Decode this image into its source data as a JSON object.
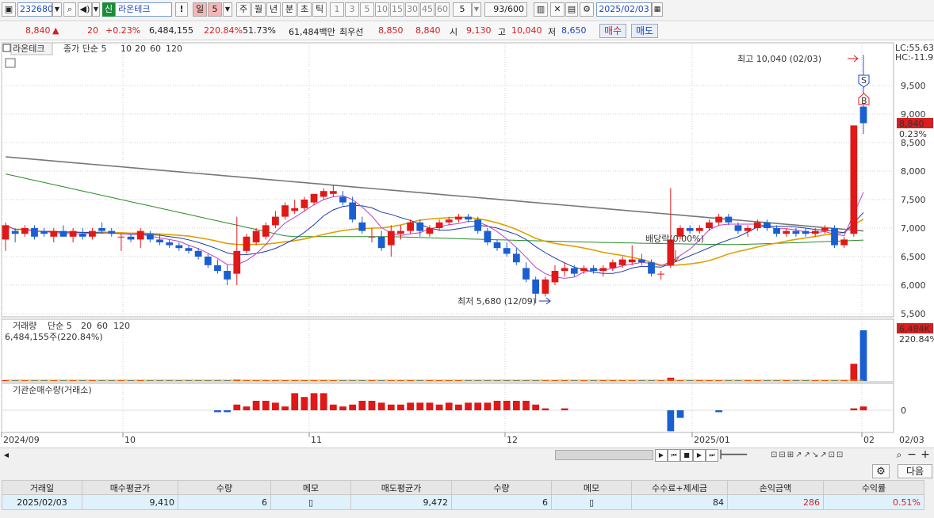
{
  "toolbar": {
    "code": "232680",
    "sin_badge": "신",
    "stock_name": "라온테크",
    "excl": "!",
    "period_day": "일",
    "period_num": "5",
    "week": "주",
    "month": "월",
    "year": "년",
    "minute": "분",
    "second": "초",
    "tick": "틱",
    "intervals": [
      "1",
      "3",
      "5",
      "10",
      "15",
      "30",
      "45",
      "60"
    ],
    "count_select": "5",
    "bar_count": "93/600",
    "date": "2025/02/03"
  },
  "quote": {
    "price": "8,840",
    "arrow": "▲",
    "change": "20",
    "change_pct": "+0.23%",
    "volume": "6,484,155",
    "volume_pct": "220.84%",
    "ratio": "51.73%",
    "amount": "61,484백만",
    "best_ask_label": "최우선",
    "best_ask": "8,850",
    "best_bid": "8,840",
    "open_label": "시",
    "open": "9,130",
    "high_label": "고",
    "high": "10,040",
    "low_label": "저",
    "low": "8,650",
    "buy_button": "매수",
    "sell_button": "매도"
  },
  "chart_data": [
    {
      "type": "candlestick",
      "legend_name": "라온테크",
      "legend_ma": [
        "종가 단순 5",
        "10",
        "20",
        "60",
        "120"
      ],
      "ma_colors": {
        "5": "#c040c0",
        "10": "#1e3aa8",
        "20": "#e0a000",
        "60": "#2a8a2a",
        "120": "#777777"
      },
      "y_ticks": [
        "9,500",
        "9,000",
        "8,500",
        "8,000",
        "7,500",
        "7,000",
        "6,500",
        "6,000",
        "5,500"
      ],
      "ylim": [
        5500,
        10040
      ],
      "x_ticks": [
        "2024/09",
        "10",
        "11",
        "12",
        "2025/01",
        "02",
        "02/03"
      ],
      "right_labels": {
        "lc": "LC:55.63",
        "hc": "HC:-11.9",
        "price": "8,840",
        "pct": "0.23%"
      },
      "annotations": {
        "high": "최고 10,040 (02/03)",
        "low": "최저 5,680 (12/09)",
        "dividend": "배당락(0.00%)",
        "sell_mark": "S",
        "buy_mark": "B"
      },
      "candles": [
        [
          6800,
          7100,
          6600,
          7050
        ],
        [
          6950,
          7000,
          6750,
          6900
        ],
        [
          6900,
          7050,
          6850,
          7000
        ],
        [
          7000,
          7050,
          6800,
          6850
        ],
        [
          6950,
          7000,
          6850,
          6900
        ],
        [
          6850,
          7000,
          6750,
          6950
        ],
        [
          6950,
          7050,
          6850,
          6850
        ],
        [
          6850,
          7000,
          6750,
          6950
        ],
        [
          6900,
          7000,
          6800,
          6850
        ],
        [
          6850,
          7000,
          6800,
          6950
        ],
        [
          7000,
          7100,
          6900,
          6950
        ],
        [
          6950,
          7000,
          6850,
          6900
        ],
        [
          6850,
          6900,
          6600,
          6850
        ],
        [
          6850,
          6900,
          6750,
          6800
        ],
        [
          6800,
          7000,
          6650,
          6950
        ],
        [
          6900,
          6950,
          6750,
          6800
        ],
        [
          6800,
          6900,
          6700,
          6750
        ],
        [
          6750,
          6800,
          6650,
          6700
        ],
        [
          6700,
          6750,
          6600,
          6650
        ],
        [
          6650,
          6700,
          6550,
          6600
        ],
        [
          6600,
          6650,
          6450,
          6500
        ],
        [
          6500,
          6550,
          6300,
          6350
        ],
        [
          6350,
          6450,
          6200,
          6250
        ],
        [
          6250,
          6350,
          6000,
          6100
        ],
        [
          6200,
          7200,
          6000,
          6600
        ],
        [
          6600,
          6900,
          6550,
          6850
        ],
        [
          6750,
          7000,
          6700,
          6950
        ],
        [
          6850,
          7100,
          6800,
          7050
        ],
        [
          7050,
          7300,
          7000,
          7200
        ],
        [
          7200,
          7450,
          7150,
          7400
        ],
        [
          7300,
          7500,
          7250,
          7350
        ],
        [
          7350,
          7550,
          7300,
          7500
        ],
        [
          7450,
          7600,
          7400,
          7600
        ],
        [
          7550,
          7700,
          7500,
          7650
        ],
        [
          7600,
          7750,
          7550,
          7650
        ],
        [
          7550,
          7650,
          7400,
          7450
        ],
        [
          7450,
          7550,
          7100,
          7150
        ],
        [
          7100,
          7200,
          6900,
          6950
        ],
        [
          6850,
          7000,
          6750,
          6850
        ],
        [
          6850,
          6950,
          6600,
          6650
        ],
        [
          6700,
          7050,
          6500,
          6950
        ],
        [
          6900,
          7050,
          6800,
          6950
        ],
        [
          6950,
          7150,
          6900,
          7100
        ],
        [
          7100,
          7150,
          6850,
          6950
        ],
        [
          6900,
          7050,
          6850,
          7000
        ],
        [
          7000,
          7150,
          6950,
          7100
        ],
        [
          7100,
          7200,
          7050,
          7150
        ],
        [
          7150,
          7250,
          7100,
          7200
        ],
        [
          7200,
          7250,
          7100,
          7150
        ],
        [
          7150,
          7200,
          6900,
          6950
        ],
        [
          6950,
          7000,
          6700,
          6750
        ],
        [
          6750,
          6800,
          6600,
          6650
        ],
        [
          6650,
          6750,
          6500,
          6550
        ],
        [
          6550,
          6650,
          6350,
          6400
        ],
        [
          6300,
          6400,
          6050,
          6100
        ],
        [
          6100,
          6150,
          5680,
          5850
        ],
        [
          5850,
          6150,
          5800,
          6100
        ],
        [
          6050,
          6350,
          6000,
          6250
        ],
        [
          6250,
          6400,
          6150,
          6300
        ],
        [
          6300,
          6350,
          6150,
          6200
        ],
        [
          6250,
          6350,
          6200,
          6300
        ],
        [
          6300,
          6350,
          6200,
          6250
        ],
        [
          6250,
          6350,
          6150,
          6300
        ],
        [
          6300,
          6450,
          6250,
          6400
        ],
        [
          6350,
          6500,
          6300,
          6450
        ],
        [
          6400,
          6700,
          6350,
          6450
        ],
        [
          6450,
          6550,
          6350,
          6400
        ],
        [
          6400,
          6450,
          6150,
          6200
        ],
        [
          6200,
          6250,
          6100,
          6200
        ],
        [
          6350,
          7700,
          6300,
          6800
        ],
        [
          6850,
          7050,
          6800,
          7000
        ],
        [
          7000,
          7050,
          6900,
          6950
        ],
        [
          6950,
          7050,
          6900,
          7000
        ],
        [
          7000,
          7150,
          6950,
          7100
        ],
        [
          7100,
          7250,
          7050,
          7200
        ],
        [
          7200,
          7250,
          7050,
          7100
        ],
        [
          7050,
          7100,
          6900,
          6950
        ],
        [
          6950,
          7050,
          6850,
          7000
        ],
        [
          7000,
          7150,
          6950,
          7100
        ],
        [
          7100,
          7150,
          6950,
          7000
        ],
        [
          7000,
          7050,
          6850,
          6900
        ],
        [
          6900,
          7000,
          6850,
          6950
        ],
        [
          6950,
          7000,
          6850,
          6900
        ],
        [
          6950,
          7000,
          6850,
          6900
        ],
        [
          6900,
          7000,
          6850,
          6950
        ],
        [
          6950,
          7050,
          6900,
          7000
        ],
        [
          7000,
          7050,
          6650,
          6700
        ],
        [
          6700,
          6850,
          6650,
          6800
        ],
        [
          6900,
          8800,
          6850,
          8800
        ],
        [
          9130,
          10040,
          8650,
          8840
        ]
      ]
    },
    {
      "type": "bar",
      "legend_name": "거래량",
      "legend_ma": [
        "단순 5",
        "20",
        "60",
        "120"
      ],
      "volume_text": "6,484,155주(220.84%)",
      "right_labels": {
        "value": "6,484K",
        "pct": "220.84%"
      },
      "values_k": [
        60,
        50,
        45,
        55,
        40,
        50,
        45,
        40,
        50,
        45,
        40,
        45,
        40,
        45,
        50,
        40,
        45,
        40,
        45,
        40,
        40,
        45,
        50,
        60,
        180,
        120,
        100,
        90,
        110,
        100,
        95,
        100,
        110,
        90,
        80,
        90,
        85,
        80,
        75,
        80,
        85,
        80,
        75,
        80,
        70,
        75,
        80,
        70,
        75,
        70,
        70,
        75,
        80,
        85,
        90,
        120,
        100,
        85,
        80,
        75,
        70,
        80,
        85,
        90,
        80,
        75,
        70,
        80,
        85,
        420,
        150,
        120,
        100,
        90,
        110,
        100,
        85,
        80,
        90,
        80,
        75,
        70,
        70,
        80,
        85,
        90,
        85,
        95,
        2200,
        6484
      ]
    },
    {
      "type": "bar",
      "legend_name": "기관순매수량(거래소)",
      "y_ticks": [
        "0"
      ],
      "values": [
        0,
        0,
        0,
        0,
        0,
        0,
        0,
        0,
        0,
        0,
        0,
        0,
        0,
        0,
        0,
        0,
        0,
        0,
        0,
        0,
        0,
        0,
        -1,
        -1,
        3,
        2,
        5,
        5,
        4,
        2,
        9,
        7,
        9,
        9,
        3,
        2,
        3,
        5,
        5,
        4,
        3,
        3,
        4,
        4,
        4,
        3,
        4,
        3,
        4,
        4,
        4,
        5,
        5,
        5,
        5,
        3,
        1,
        0,
        1,
        0,
        0,
        0,
        0,
        0,
        0,
        0,
        0,
        0,
        0,
        -11,
        -4,
        0,
        0,
        0,
        -1,
        0,
        0,
        0,
        0,
        0,
        0,
        0,
        0,
        0,
        0,
        0,
        0,
        0,
        1,
        2
      ]
    }
  ],
  "table": {
    "headers": [
      "거래일",
      "매수평균가",
      "수량",
      "메모",
      "매도평균가",
      "수량",
      "메모",
      "수수료+제세금",
      "손익금액",
      "수익률"
    ],
    "row": [
      "2025/02/03",
      "9,410",
      "6",
      "",
      "9,472",
      "6",
      "",
      "84",
      "286",
      "0.51%"
    ],
    "next_button": "다음"
  }
}
